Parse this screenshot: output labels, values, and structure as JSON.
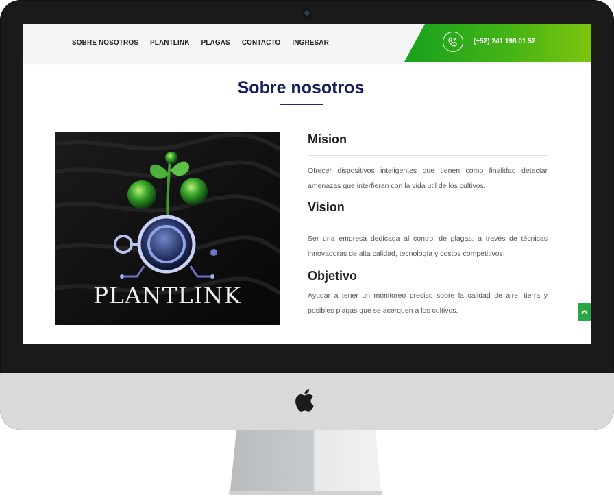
{
  "nav": {
    "links": [
      "SOBRE NOSOTROS",
      "PLANTLINK",
      "PLAGAS",
      "CONTACTO",
      "INGRESAR"
    ],
    "phone": "(+52) 241 198 01 52"
  },
  "main": {
    "section_title": "Sobre nosotros",
    "image": {
      "brand_text": "PLANTLINK"
    },
    "mision": {
      "heading": "Mision",
      "text": "Ofrecer dispositivos inteligentes que tienen como finalidad detectar amenazas que interfieran con la vida util de los cultivos."
    },
    "vision": {
      "heading": "Vision",
      "text": "Ser una empresa dedicada al control de plagas, a través de técnicas innovadoras de alta calidad, tecnología y costos competitivos."
    },
    "objetivo": {
      "heading": "Objetivo",
      "text": "Ayudar a tener un monitoreo preciso sobre la calidad de aire, tierra y posibles plagas que se acerquen a los cultivos."
    }
  },
  "colors": {
    "accent_green": "#28a745",
    "title_navy": "#141c5c"
  },
  "icons": [
    "phone-icon",
    "chevron-up-icon",
    "apple-logo-icon"
  ]
}
